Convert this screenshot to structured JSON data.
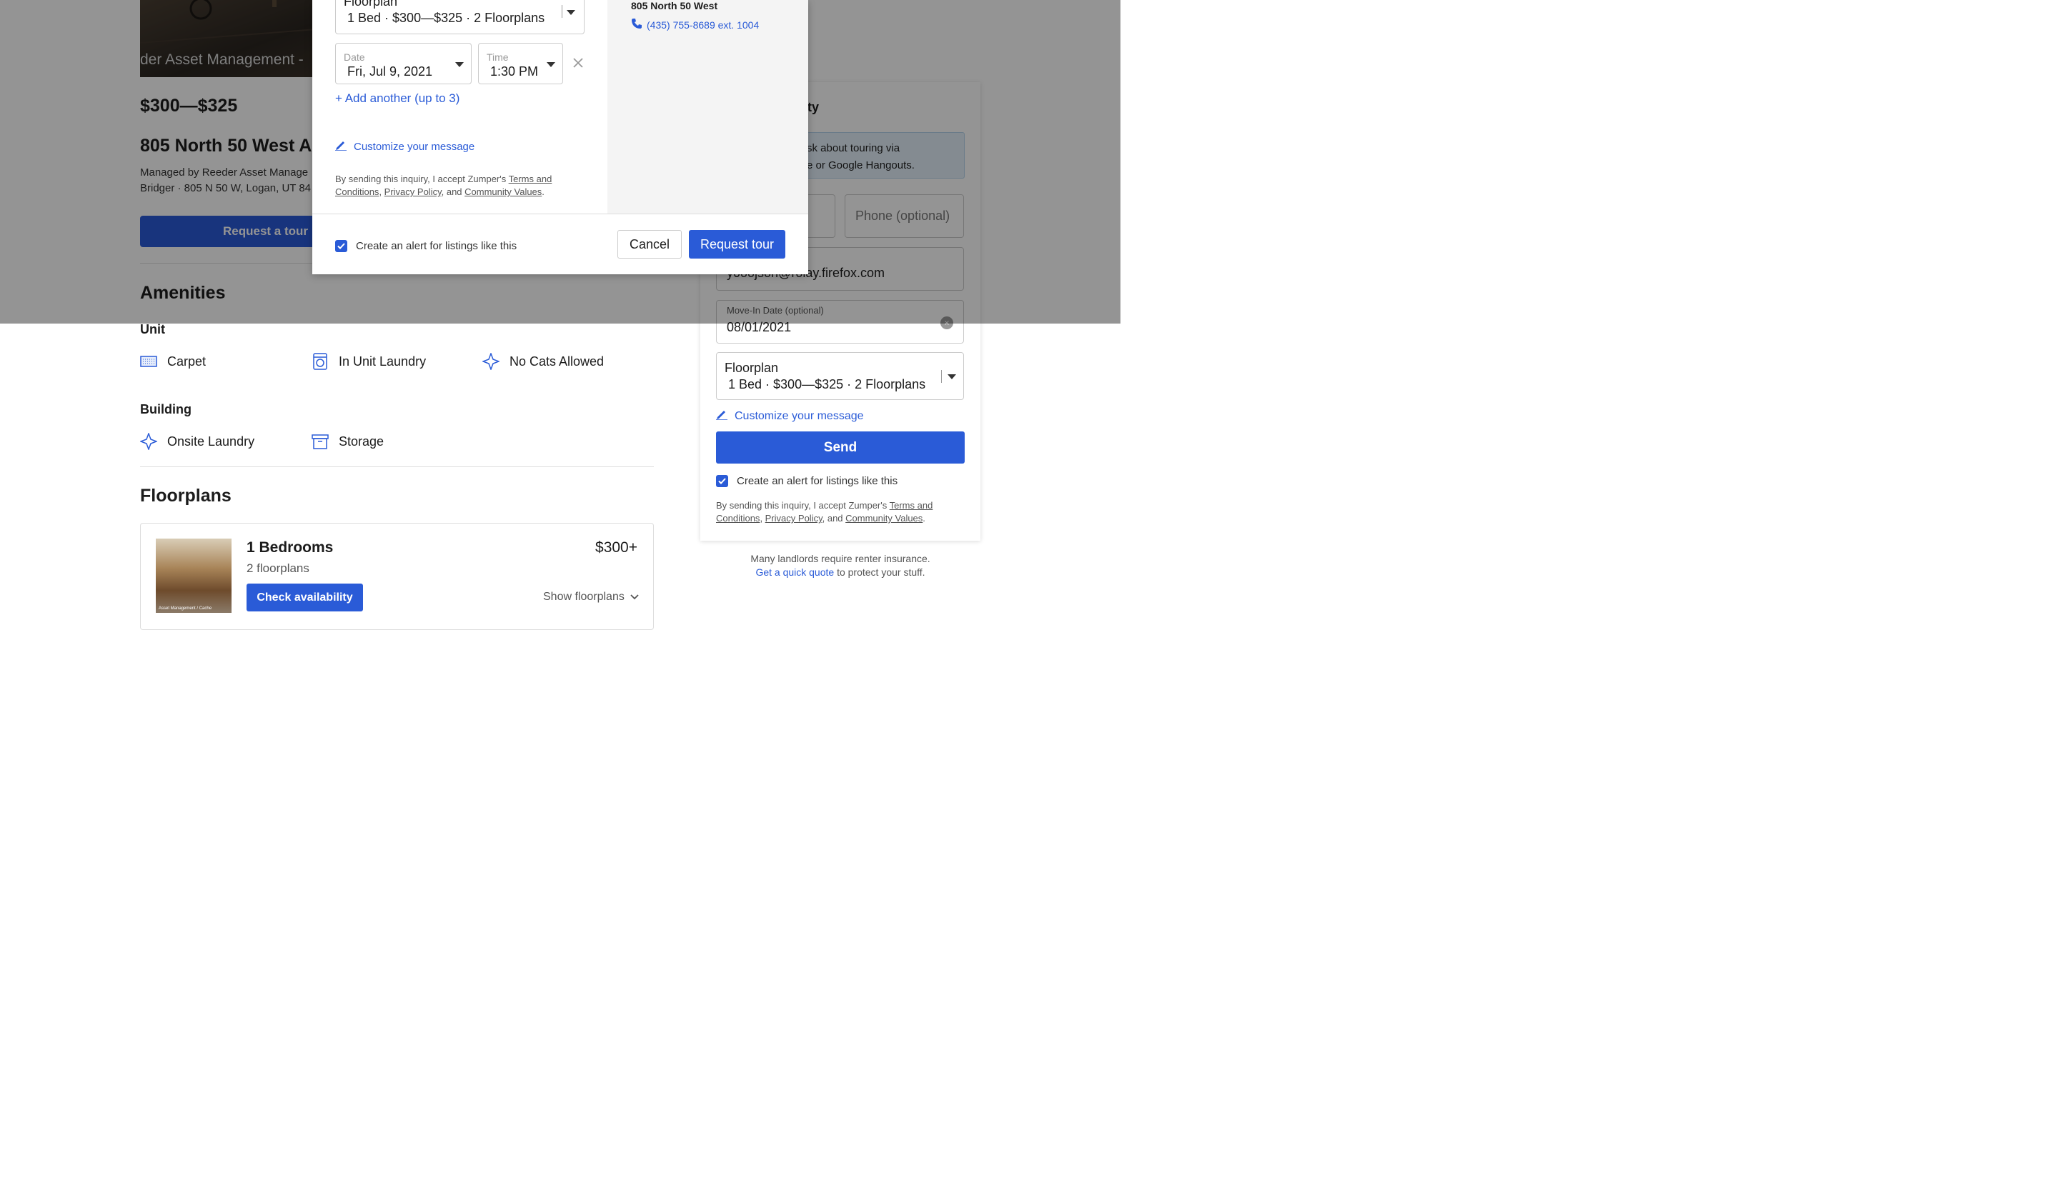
{
  "listing": {
    "image_overlay": "der Asset Management -",
    "price": "$300—$325",
    "title": "805 North 50 West Ap",
    "managed_line1": "Managed by Reeder Asset Manage",
    "managed_line2": "Bridger · 805 N 50 W, Logan, UT 84",
    "request_tour_label": "Request a tour"
  },
  "amenities": {
    "heading": "Amenities",
    "unit_heading": "Unit",
    "unit_items": [
      {
        "label": "Carpet",
        "icon": "carpet-icon"
      },
      {
        "label": "In Unit Laundry",
        "icon": "washer-icon"
      },
      {
        "label": "No Cats Allowed",
        "icon": "sparkle-icon"
      }
    ],
    "building_heading": "Building",
    "building_items": [
      {
        "label": "Onsite Laundry",
        "icon": "sparkle-icon"
      },
      {
        "label": "Storage",
        "icon": "storage-box-icon"
      }
    ]
  },
  "floorplans": {
    "heading": "Floorplans",
    "card": {
      "image_caption": "Asset Management / Cache",
      "title": "1 Bedrooms",
      "subtitle": "2 floorplans",
      "price": "$300+",
      "check_label": "Check availability",
      "show_label": "Show floorplans"
    }
  },
  "sidebar": {
    "header_fragment": "ty",
    "note_line1": "sk about touring via",
    "note_line2": "e or Google Hangouts.",
    "phone_placeholder": "Phone (optional)",
    "email_value": "y0oojson@rolay.firefox.com",
    "move_in_label": "Move-In Date (optional)",
    "move_in_value": "08/01/2021",
    "floorplan_label": "Floorplan",
    "floorplan_value": "1 Bed · $300—$325 · 2 Floorplans",
    "customize_label": "Customize your message",
    "send_label": "Send",
    "alert_label": "Create an alert for listings like this",
    "legal_prefix": "By sending this inquiry, I accept Zumper's ",
    "terms_a": "Terms and",
    "terms_b": "Conditions",
    "privacy": "Privacy Policy",
    "and": ", and ",
    "community": "Community Values",
    "insurance_line": "Many landlords require renter insurance.",
    "quote_link": "Get a quick quote",
    "quote_suffix": " to protect your stuff."
  },
  "modal": {
    "floorplan_label": "Floorplan",
    "floorplan_value": "1 Bed · $300—$325 · 2 Floorplans",
    "date_label": "Date",
    "date_value": "Fri, Jul 9, 2021",
    "time_label": "Time",
    "time_value": "1:30 PM",
    "add_another": "+ Add another (up to 3)",
    "customize_label": "Customize your message",
    "legal_prefix": "By sending this inquiry, I accept Zumper's ",
    "terms_a": "Terms and",
    "terms_b": "Conditions",
    "privacy": "Privacy Policy",
    "and": ", and ",
    "community": "Community Values",
    "alert_label": "Create an alert for listings like this",
    "cancel_label": "Cancel",
    "request_label": "Request tour",
    "address": "805 North 50 West",
    "phone": "(435) 755-8689 ext. 1004"
  },
  "colors": {
    "accent": "#2a5bd7",
    "overlay": "rgba(0,0,0,0.42)"
  }
}
